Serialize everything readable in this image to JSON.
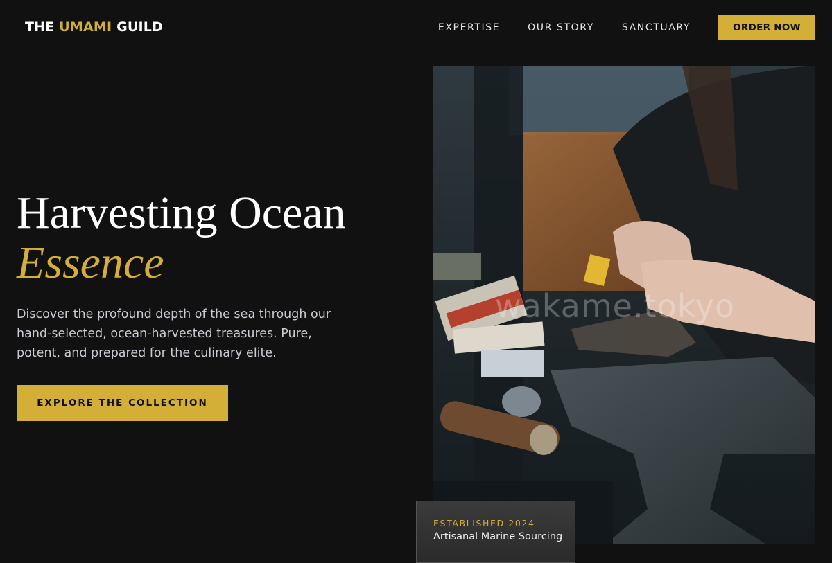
{
  "header": {
    "logo_part1": "THE ",
    "logo_accent": "UMAMI",
    "logo_part2": " GUILD",
    "nav": [
      "EXPERTISE",
      "OUR STORY",
      "SANCTUARY"
    ],
    "order_label": "ORDER NOW"
  },
  "hero": {
    "title_line1": "Harvesting Ocean",
    "title_line2": "Essence",
    "description": "Discover the profound depth of the sea through our hand-selected, ocean-harvested treasures. Pure, potent, and prepared for the culinary elite.",
    "cta_label": "EXPLORE THE COLLECTION"
  },
  "image": {
    "watermark": "wakame.tokyo"
  },
  "badge": {
    "eyebrow": "ESTABLISHED 2024",
    "text": "Artisanal Marine Sourcing"
  },
  "colors": {
    "accent": "#d4af37",
    "background": "#111111"
  }
}
